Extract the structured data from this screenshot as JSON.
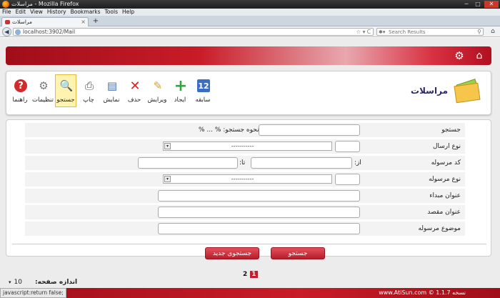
{
  "browser": {
    "window_title": "مراسلات - Mozilla Firefox",
    "menu": [
      "File",
      "Edit",
      "View",
      "History",
      "Bookmarks",
      "Tools",
      "Help"
    ],
    "tab_title": "مراسلات",
    "url": "localhost:3902/Mail",
    "search_placeholder": "Search Results"
  },
  "module": {
    "title": "مراسلات"
  },
  "toolbar": {
    "history": "سابقه",
    "add": "ایجاد",
    "edit": "ویرایش",
    "delete": "حذف",
    "show": "نمایش",
    "print": "چاپ",
    "search": "جستجو",
    "settings": "تنظیمات",
    "help": "راهنما"
  },
  "form": {
    "search_label": "جستجو",
    "search_hint": "نحوه جستجو: % ... %",
    "send_type_label": "نوع ارسال",
    "send_type_value": "-----------",
    "code_label": "کد مرسوله",
    "from_label": "از:",
    "to_label": "تا:",
    "parcel_type_label": "نوع مرسوله",
    "parcel_type_value": "-----------",
    "origin_label": "عنوان مبداء",
    "dest_label": "عنوان مقصد",
    "subject_label": "موضوع مرسوله",
    "search_button": "جستجو",
    "new_search_button": "جستجوی جدید"
  },
  "pager": {
    "pages": [
      "1",
      "2"
    ],
    "current": "1",
    "page_size_label": "اندازه صفحه:",
    "page_size": "10"
  },
  "footer": {
    "copyright": "www.AtiSun.com © نسخه 1.1.7",
    "status": "javascript:return false;"
  }
}
